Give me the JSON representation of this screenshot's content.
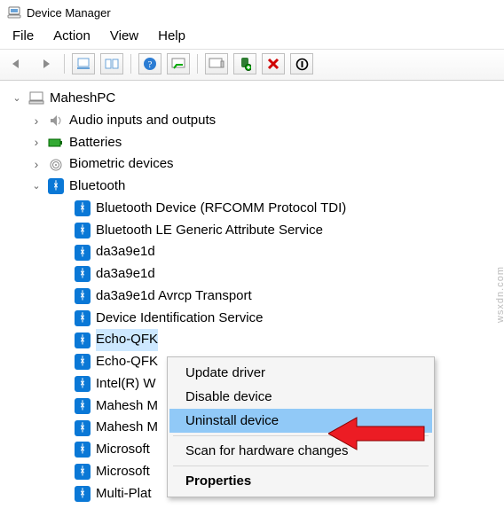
{
  "window": {
    "title": "Device Manager"
  },
  "menu": {
    "file": "File",
    "action": "Action",
    "view": "View",
    "help": "Help"
  },
  "tree": {
    "root": "MaheshPC",
    "cats": {
      "audio": "Audio inputs and outputs",
      "batt": "Batteries",
      "bio": "Biometric devices",
      "bt": "Bluetooth"
    },
    "bt_items": [
      "Bluetooth Device (RFCOMM Protocol TDI)",
      "Bluetooth LE Generic Attribute Service",
      "da3a9e1d",
      "da3a9e1d",
      "da3a9e1d Avrcp Transport",
      "Device Identification Service",
      "Echo-QFK",
      "Echo-QFK",
      "Intel(R) W",
      "Mahesh M",
      "Mahesh M",
      "Microsoft",
      "Microsoft",
      "Multi-Plat"
    ]
  },
  "context": {
    "update": "Update driver",
    "disable": "Disable device",
    "uninstall": "Uninstall device",
    "scan": "Scan for hardware changes",
    "props": "Properties"
  },
  "watermark": "wsxdn.com"
}
